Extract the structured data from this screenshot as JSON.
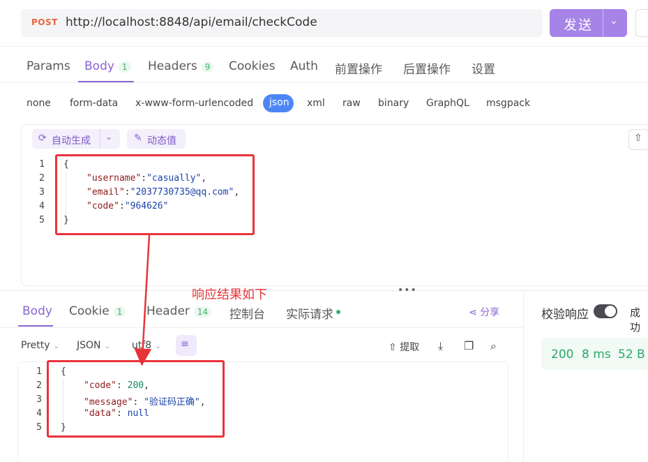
{
  "request": {
    "method": "POST",
    "url": "http://localhost:8848/api/email/checkCode",
    "send_label": "发送",
    "send_caret": "⌄"
  },
  "tabs": [
    {
      "label": "Params",
      "badge": ""
    },
    {
      "label": "Body",
      "badge": "1"
    },
    {
      "label": "Headers",
      "badge": "9"
    },
    {
      "label": "Cookies",
      "badge": ""
    },
    {
      "label": "Auth",
      "badge": ""
    },
    {
      "label": "前置操作",
      "badge": ""
    },
    {
      "label": "后置操作",
      "badge": ""
    },
    {
      "label": "设置",
      "badge": ""
    }
  ],
  "body_types": [
    "none",
    "form-data",
    "x-www-form-urlencoded",
    "json",
    "xml",
    "raw",
    "binary",
    "GraphQL",
    "msgpack"
  ],
  "editor_toolbar": {
    "auto_generate": "自动生成",
    "dynamic_value": "动态值"
  },
  "request_body": {
    "line_numbers": [
      "1",
      "2",
      "3",
      "4",
      "5"
    ],
    "open_brace": "{",
    "close_brace": "}",
    "fields": [
      {
        "key": "\"username\"",
        "value": "\"casually\"",
        "trail": ","
      },
      {
        "key": "\"email\"",
        "value": "\"2037730735@qq.com\"",
        "trail": ","
      },
      {
        "key": "\"code\"",
        "value": "\"964626\"",
        "trail": ""
      }
    ]
  },
  "annotation": {
    "text": "响应结果如下",
    "color": "#e8333a"
  },
  "response_tabs": [
    {
      "label": "Body",
      "badge": ""
    },
    {
      "label": "Cookie",
      "badge": "1"
    },
    {
      "label": "Header",
      "badge": "14"
    },
    {
      "label": "控制台",
      "badge": ""
    },
    {
      "label": "实际请求",
      "badge": ""
    }
  ],
  "share_label": "分享",
  "response_toolbar": {
    "format": "Pretty",
    "lang": "JSON",
    "encoding": "utf8",
    "extract": "提取"
  },
  "response_body": {
    "line_numbers": [
      "1",
      "2",
      "3",
      "4",
      "5"
    ],
    "open_brace": "{",
    "close_brace": "}",
    "code_key": "\"code\"",
    "code_value": "200",
    "message_key": "\"message\"",
    "message_value": "\"验证码正确\"",
    "data_key": "\"data\"",
    "data_value": "null"
  },
  "validation": {
    "label": "校验响应",
    "result": "成功"
  },
  "status": {
    "code": "200",
    "time": "8 ms",
    "size": "52 B"
  },
  "colors": {
    "accent": "#8a63d2",
    "send_button": "#a683e6",
    "json_chip": "#4c86f5",
    "highlight": "#e8333a",
    "success": "#2fa866"
  }
}
